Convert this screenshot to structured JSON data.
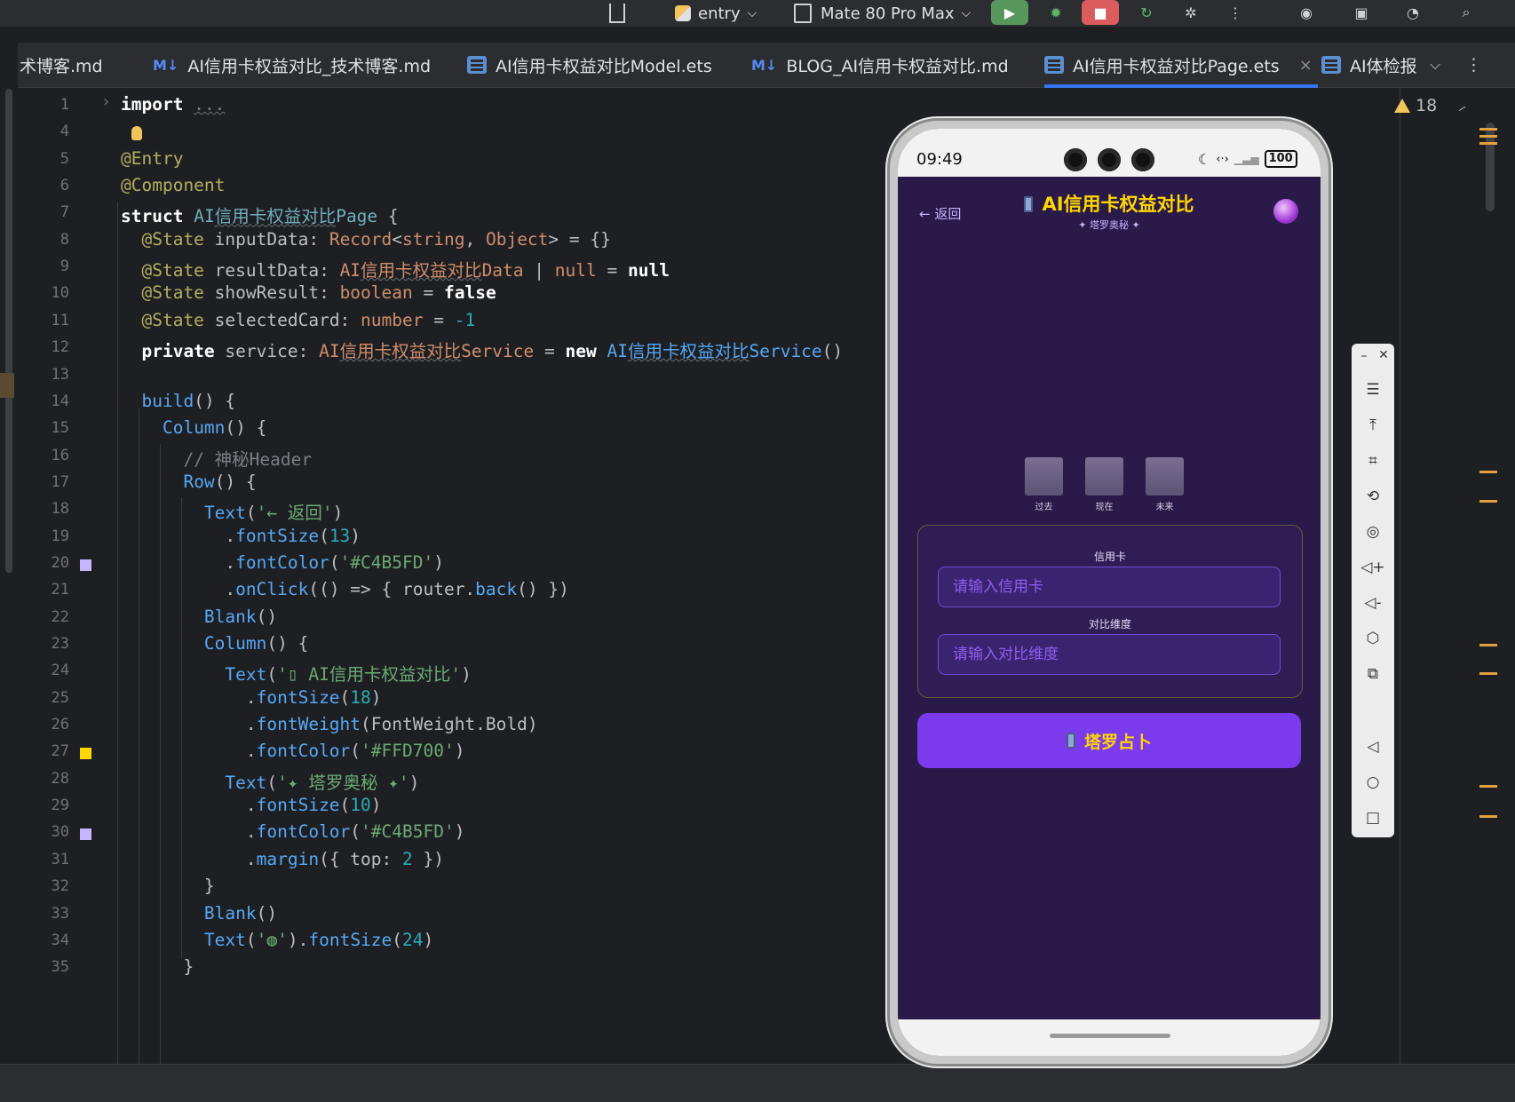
{
  "toolbar": {
    "module": "entry",
    "device": "Mate 80 Pro Max"
  },
  "tabs": [
    {
      "label": "术博客.md",
      "type": "md"
    },
    {
      "label": "AI信用卡权益对比_技术博客.md",
      "type": "md"
    },
    {
      "label": "AI信用卡权益对比Model.ets",
      "type": "ets"
    },
    {
      "label": "BLOG_AI信用卡权益对比.md",
      "type": "md"
    },
    {
      "label": "AI信用卡权益对比Page.ets",
      "type": "ets",
      "active": true
    },
    {
      "label": "AI体检报",
      "type": "ets"
    }
  ],
  "md_badge": "M↓",
  "editor": {
    "warning_count": "18",
    "line_numbers": [
      "1",
      "4",
      "5",
      "6",
      "7",
      "8",
      "9",
      "10",
      "11",
      "12",
      "13",
      "14",
      "15",
      "16",
      "17",
      "18",
      "19",
      "20",
      "21",
      "22",
      "23",
      "24",
      "25",
      "26",
      "27",
      "28",
      "29",
      "30",
      "31",
      "32",
      "33",
      "34",
      "35"
    ]
  },
  "phone": {
    "time": "09:49",
    "battery": "100",
    "back_label": "← 返回",
    "title": "AI信用卡权益对比",
    "subtitle": "✦ 塔罗奥秘 ✦",
    "cards": [
      "过去",
      "现在",
      "未来"
    ],
    "fields": [
      {
        "label": "信用卡",
        "placeholder": "请输入信用卡"
      },
      {
        "label": "对比维度",
        "placeholder": "请输入对比维度"
      }
    ],
    "button_label": "塔罗占卜"
  },
  "colors": {
    "accent_purple": "#7C3AED",
    "gold": "#FFD700",
    "lavender": "#C4B5FD"
  }
}
